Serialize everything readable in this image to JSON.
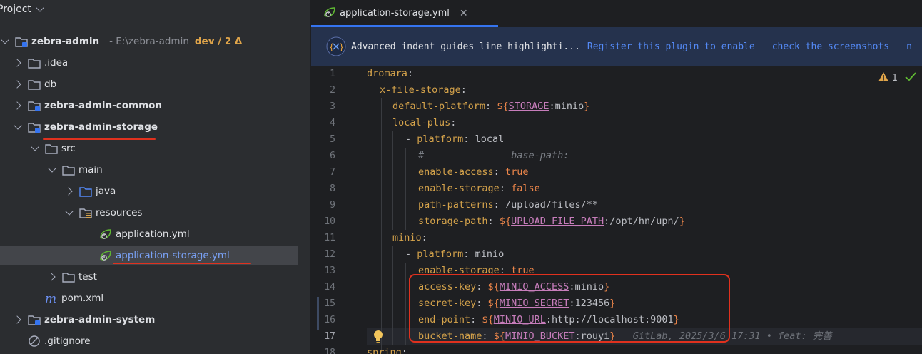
{
  "project": {
    "title": "Project",
    "tree": [
      {
        "label": "zebra-admin",
        "path": " - E:\\zebra-admin",
        "branch": "dev / 2 Δ"
      },
      {
        "label": ".idea"
      },
      {
        "label": "db"
      },
      {
        "label": "zebra-admin-common"
      },
      {
        "label": "zebra-admin-storage"
      },
      {
        "label": "src"
      },
      {
        "label": "main"
      },
      {
        "label": "java"
      },
      {
        "label": "resources"
      },
      {
        "label": "application.yml"
      },
      {
        "label": "application-storage.yml"
      },
      {
        "label": "test"
      },
      {
        "label": "pom.xml"
      },
      {
        "label": "zebra-admin-system"
      },
      {
        "label": ".gitignore"
      }
    ]
  },
  "editor": {
    "tab_label": "application-storage.yml",
    "tab_close": "✕",
    "banner": {
      "text": "Advanced indent guides line highlighti...",
      "link_register": "Register this plugin to enable",
      "link_screenshots": "check the screenshots",
      "link_more": "n"
    },
    "warnings": "1",
    "line_numbers": [
      "1",
      "2",
      "3",
      "4",
      "5",
      "6",
      "7",
      "8",
      "9",
      "10",
      "11",
      "12",
      "13",
      "14",
      "15",
      "16",
      "17",
      "18"
    ],
    "lines": {
      "l1_key": "dromara",
      "l2_key": "x-file-storage",
      "l3_key": "default-platform",
      "l3_env": "STORAGE",
      "l3_default": "minio",
      "l4_key": "local-plus",
      "l5_key": "platform",
      "l5_val": "local",
      "l6_hash": "#",
      "l6_comment": "base-path:",
      "l7_key": "enable-access",
      "l7_val": "true",
      "l8_key": "enable-storage",
      "l8_val": "false",
      "l9_key": "path-patterns",
      "l9_val": "/upload/files/**",
      "l10_key": "storage-path",
      "l10_env": "UPLOAD_FILE_PATH",
      "l10_default": "/opt/hn/upn/",
      "l11_key": "minio",
      "l12_key": "platform",
      "l12_val": "minio",
      "l13_key": "enable-storage",
      "l13_val": "true",
      "l14_key": "access-key",
      "l14_env": "MINIO_ACCESS",
      "l14_default": "minio",
      "l15_key": "secret-key",
      "l15_env": "MINIO_SECRET",
      "l15_default": "123456",
      "l16_key": "end-point",
      "l16_env": "MINIO_URL",
      "l16_default": "http://localhost:9001",
      "l17_key": "bucket-name",
      "l17_env": "MINIO_BUCKET",
      "l17_default": "rouyi",
      "l17_blame": "GitLab, 2025/3/6 17:31 • feat: 完善",
      "l18_key": "spring"
    }
  },
  "colors": {
    "annotation_red": "#e0311e",
    "accent_blue": "#3574f0",
    "yaml_key": "#d5a34b"
  }
}
